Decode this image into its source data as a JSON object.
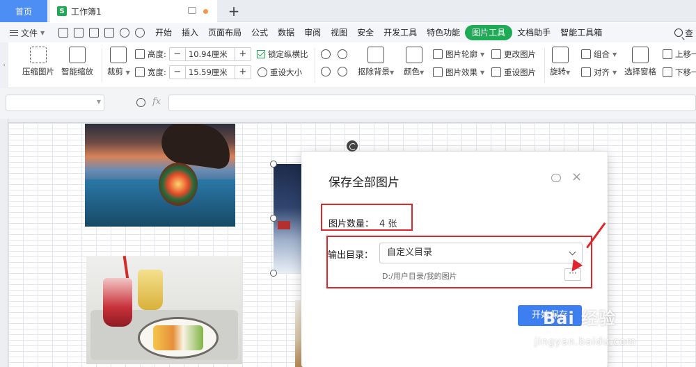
{
  "tabs": {
    "home": "首页",
    "doc_icon": "S",
    "doc_name": "工作簿1",
    "add": "+"
  },
  "menu": {
    "file": "文件",
    "items": [
      "开始",
      "插入",
      "页面布局",
      "公式",
      "数据",
      "审阅",
      "视图",
      "安全",
      "开发工具",
      "特色功能",
      "图片工具",
      "文档助手",
      "智能工具箱"
    ],
    "active_index": 10,
    "search": "查"
  },
  "ribbon": {
    "compress": "压缩图片",
    "smart_zoom": "智能缩放",
    "crop": "裁剪",
    "height_label": "高度:",
    "height_value": "10.94厘米",
    "width_label": "宽度:",
    "width_value": "15.59厘米",
    "minus": "−",
    "plus": "+",
    "lock_ratio": "锁定纵横比",
    "reset_size": "重设大小",
    "remove_bg": "抠除背景",
    "color": "颜色",
    "outline": "图片轮廓",
    "effect": "图片效果",
    "change_pic": "更改图片",
    "reset_pic": "重设图片",
    "rotate": "旋转",
    "group": "组合",
    "align": "对齐",
    "selection_pane": "选择窗格",
    "up_one": "上移一",
    "down_one": "下移一"
  },
  "formula": {
    "fx": "fx"
  },
  "dialog": {
    "title": "保存全部图片",
    "count_label": "图片数量：",
    "count_value": "4 张",
    "output_label": "输出目录：",
    "output_value": "自定义目录",
    "path": "D:/用户目录/我的图片",
    "browse": "···",
    "close": "×",
    "start": "开始保存"
  },
  "watermark": {
    "logo": "Bai 经验",
    "url": "jingyan.baidu.com"
  },
  "colors": {
    "accent_green": "#1faa55",
    "home_tab_blue": "#4d8ef5",
    "primary_button": "#3d7ef0",
    "annotation_red": "#e0262b"
  }
}
